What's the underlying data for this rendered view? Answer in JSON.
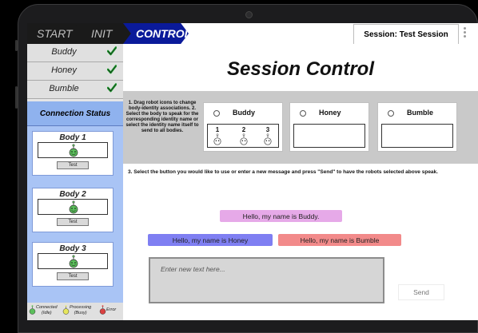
{
  "breadcrumb": {
    "start": "START",
    "init": "INIT",
    "control": "CONTROL"
  },
  "session": {
    "label": "Session: Test Session"
  },
  "sidebar": {
    "robots": [
      {
        "name": "Buddy",
        "status_icon": "green-checkmark-icon"
      },
      {
        "name": "Honey",
        "status_icon": "green-checkmark-icon"
      },
      {
        "name": "Bumble",
        "status_icon": "green-checkmark-icon"
      }
    ],
    "connection_status": {
      "title": "Connection Status",
      "bodies": [
        {
          "title": "Body 1",
          "test_label": "Test",
          "robot_color": "#5bbf5b"
        },
        {
          "title": "Body 2",
          "test_label": "Test",
          "robot_color": "#5bbf5b"
        },
        {
          "title": "Body 3",
          "test_label": "Test",
          "robot_color": "#5bbf5b"
        }
      ]
    },
    "legend": [
      {
        "line1": "Connected",
        "line2": "(Idle)",
        "color": "#5bbf5b"
      },
      {
        "line1": "Processing",
        "line2": "(Busy)",
        "color": "#e6e65c"
      },
      {
        "line1": "Error",
        "line2": "",
        "color": "#d94040"
      }
    ]
  },
  "main": {
    "title": "Session Control",
    "instructions_1_2": "1. Drag robot icons to change body-identity associations. 2. Select the body to speak for the corresponding identity name or select the identity name itself to send to all bodies.",
    "identity_cards": [
      {
        "name": "Buddy"
      },
      {
        "name": "Honey"
      },
      {
        "name": "Bumble"
      }
    ],
    "buddy_slot_numbers": [
      "1",
      "2",
      "3"
    ],
    "step3": "3. Select the button you would like to use or enter a new message and press \"Send\" to have the robots selected above speak.",
    "phrases": {
      "buddy": "Hello, my name is Buddy.",
      "honey": "Hello, my name is Honey",
      "bumble": "Hello, my name is Bumble"
    },
    "message_input": {
      "placeholder": "Enter new text here..."
    },
    "send_label": "Send"
  },
  "colors": {
    "control_tab": "#0a1a9a",
    "connection_panel": "#a9c4f5"
  }
}
